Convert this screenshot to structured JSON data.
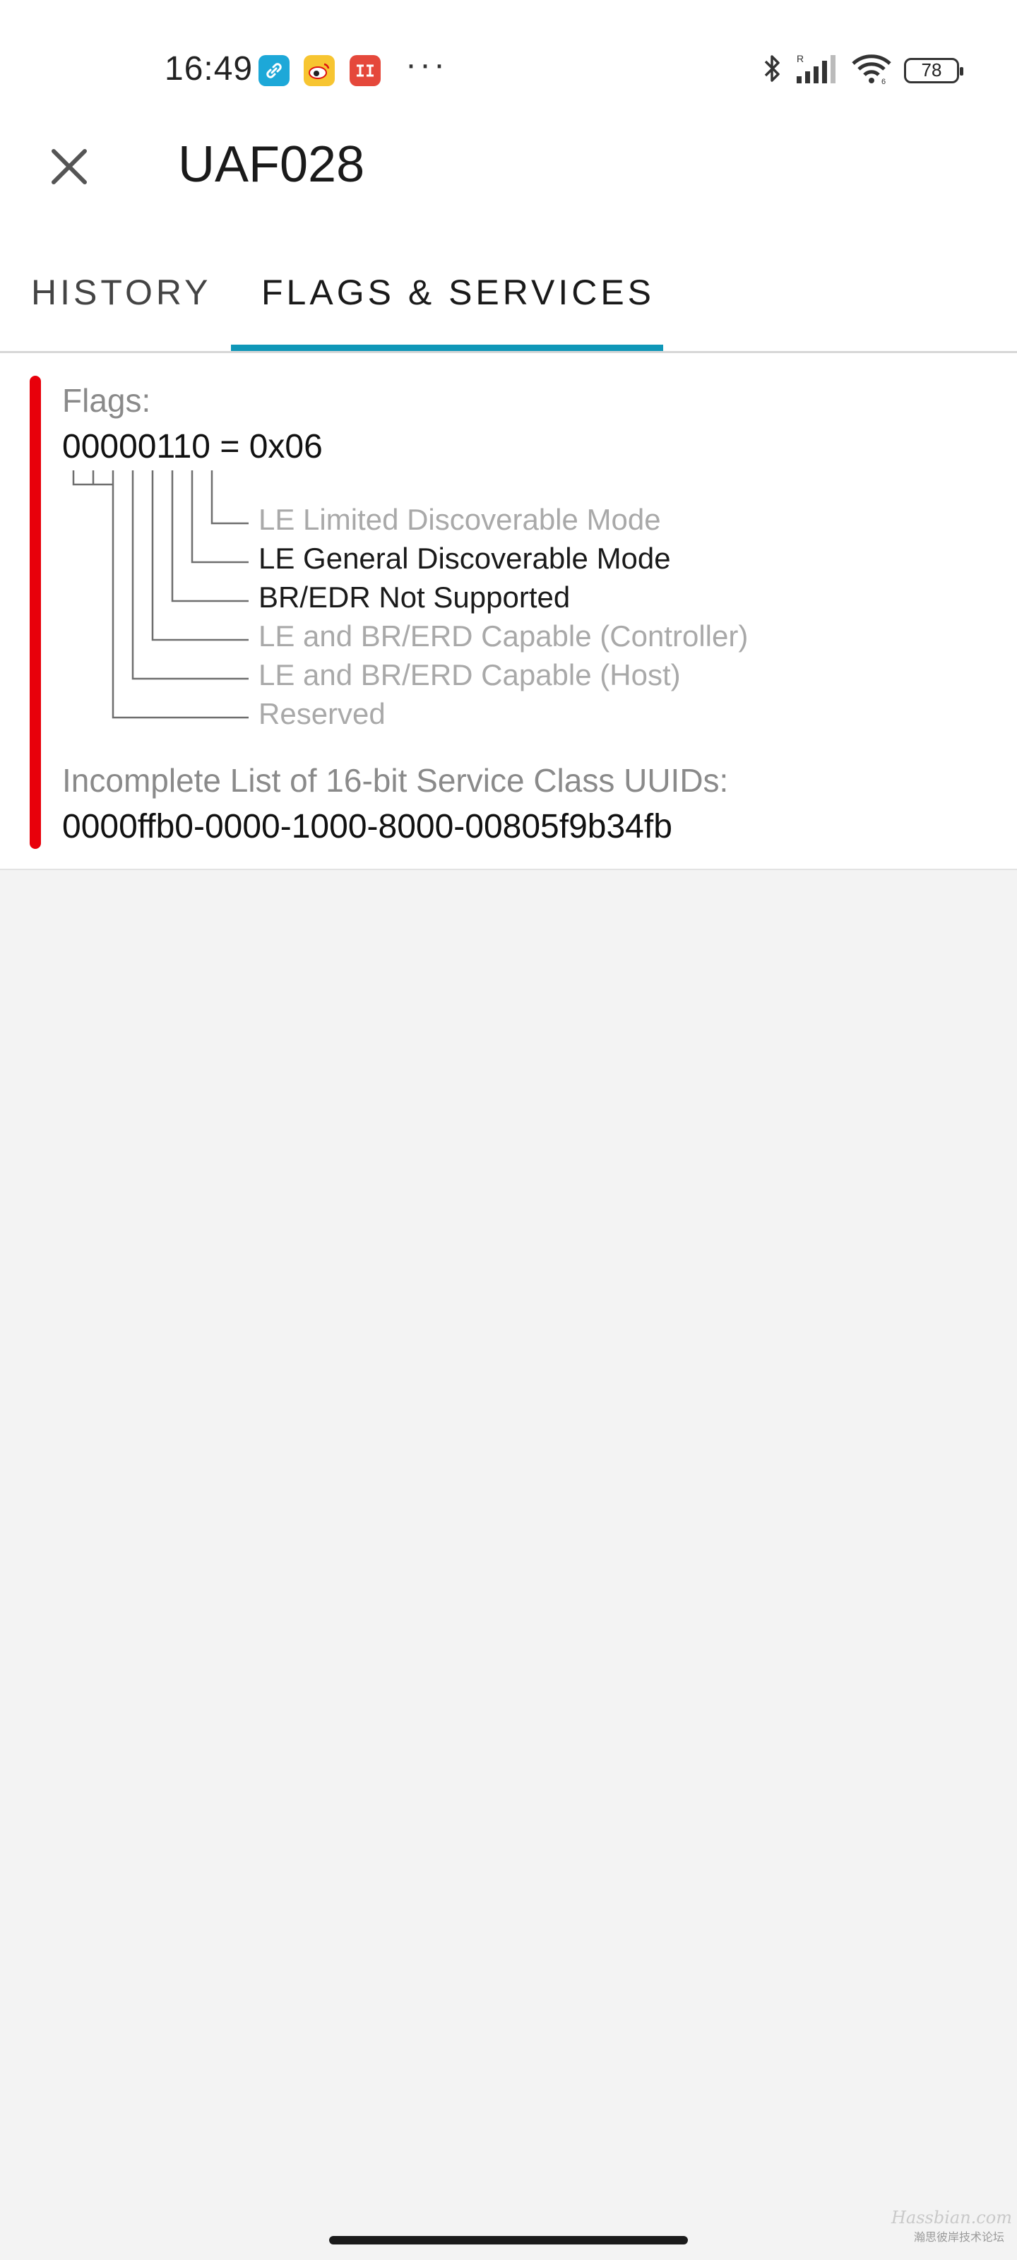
{
  "status_bar": {
    "time": "16:49",
    "more": "···",
    "battery": "78",
    "icons": [
      "link-app-icon",
      "weibo-icon",
      "dangdang-icon",
      "bluetooth-icon",
      "signal-icon",
      "wifi-icon",
      "battery-icon"
    ]
  },
  "app_bar": {
    "title": "UAF028",
    "close_icon": "close-icon"
  },
  "tabs": [
    {
      "label": "HISTORY",
      "selected": false
    },
    {
      "label": "FLAGS & SERVICES",
      "selected": true
    }
  ],
  "colors": {
    "accent": "#0f97b8",
    "indicator": "#e8000b"
  },
  "flags": {
    "label": "Flags:",
    "value": "00000110 = 0x06",
    "items": [
      {
        "label": "LE Limited Discoverable Mode",
        "active": false
      },
      {
        "label": "LE General Discoverable Mode",
        "active": true
      },
      {
        "label": "BR/EDR Not Supported",
        "active": true
      },
      {
        "label": "LE and BR/ERD Capable (Controller)",
        "active": false
      },
      {
        "label": "LE and BR/ERD Capable (Host)",
        "active": false
      },
      {
        "label": "Reserved",
        "active": false
      }
    ]
  },
  "services": {
    "label": "Incomplete List of 16-bit Service Class UUIDs:",
    "value": "0000ffb0-0000-1000-8000-00805f9b34fb"
  },
  "watermark": {
    "text": "Hassbian.com",
    "subtext": "瀚思彼岸技术论坛"
  }
}
